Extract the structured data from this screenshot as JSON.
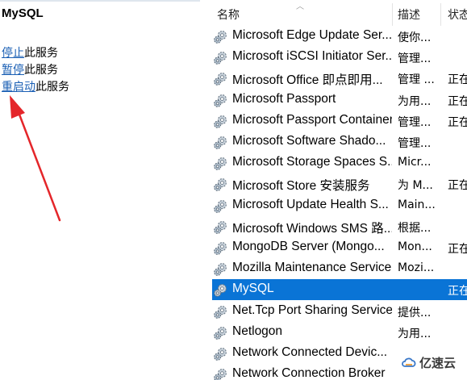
{
  "left_pane": {
    "service_title": "MySQL",
    "actions": [
      {
        "link": "停止",
        "rest": "此服务"
      },
      {
        "link": "暂停",
        "rest": "此服务"
      },
      {
        "link": "重启动",
        "rest": "此服务"
      }
    ],
    "annotation_color": "#e4262a"
  },
  "list": {
    "columns": {
      "name": "名称",
      "description": "描述",
      "status": "状态"
    },
    "rows": [
      {
        "name": "Microsoft Edge Update Ser...",
        "description": "使你...",
        "status": ""
      },
      {
        "name": "Microsoft iSCSI Initiator Ser...",
        "description": "管理...",
        "status": ""
      },
      {
        "name": "Microsoft Office 即点即用...",
        "description": "管理 ...",
        "status": "正在"
      },
      {
        "name": "Microsoft Passport",
        "description": "为用...",
        "status": "正在"
      },
      {
        "name": "Microsoft Passport Container",
        "description": "管理...",
        "status": "正在"
      },
      {
        "name": "Microsoft Software Shado...",
        "description": "管理...",
        "status": ""
      },
      {
        "name": "Microsoft Storage Spaces S...",
        "description": "Micr...",
        "status": ""
      },
      {
        "name": "Microsoft Store 安装服务",
        "description": "为 M...",
        "status": "正在"
      },
      {
        "name": "Microsoft Update Health S...",
        "description": "Main...",
        "status": ""
      },
      {
        "name": "Microsoft Windows SMS 路...",
        "description": "根据...",
        "status": ""
      },
      {
        "name": "MongoDB Server (Mongo...",
        "description": "Mon...",
        "status": "正在"
      },
      {
        "name": "Mozilla Maintenance Service",
        "description": "Mozi...",
        "status": ""
      },
      {
        "name": "MySQL",
        "description": "",
        "status": "正在",
        "selected": true
      },
      {
        "name": "Net.Tcp Port Sharing Service",
        "description": "提供...",
        "status": ""
      },
      {
        "name": "Netlogon",
        "description": "为用...",
        "status": ""
      },
      {
        "name": "Network Connected Devic...",
        "description": "",
        "status": ""
      },
      {
        "name": "Network Connection Broker",
        "description": "",
        "status": ""
      }
    ],
    "selection_color": "#0a74d6"
  },
  "watermark": {
    "text": "亿速云"
  }
}
